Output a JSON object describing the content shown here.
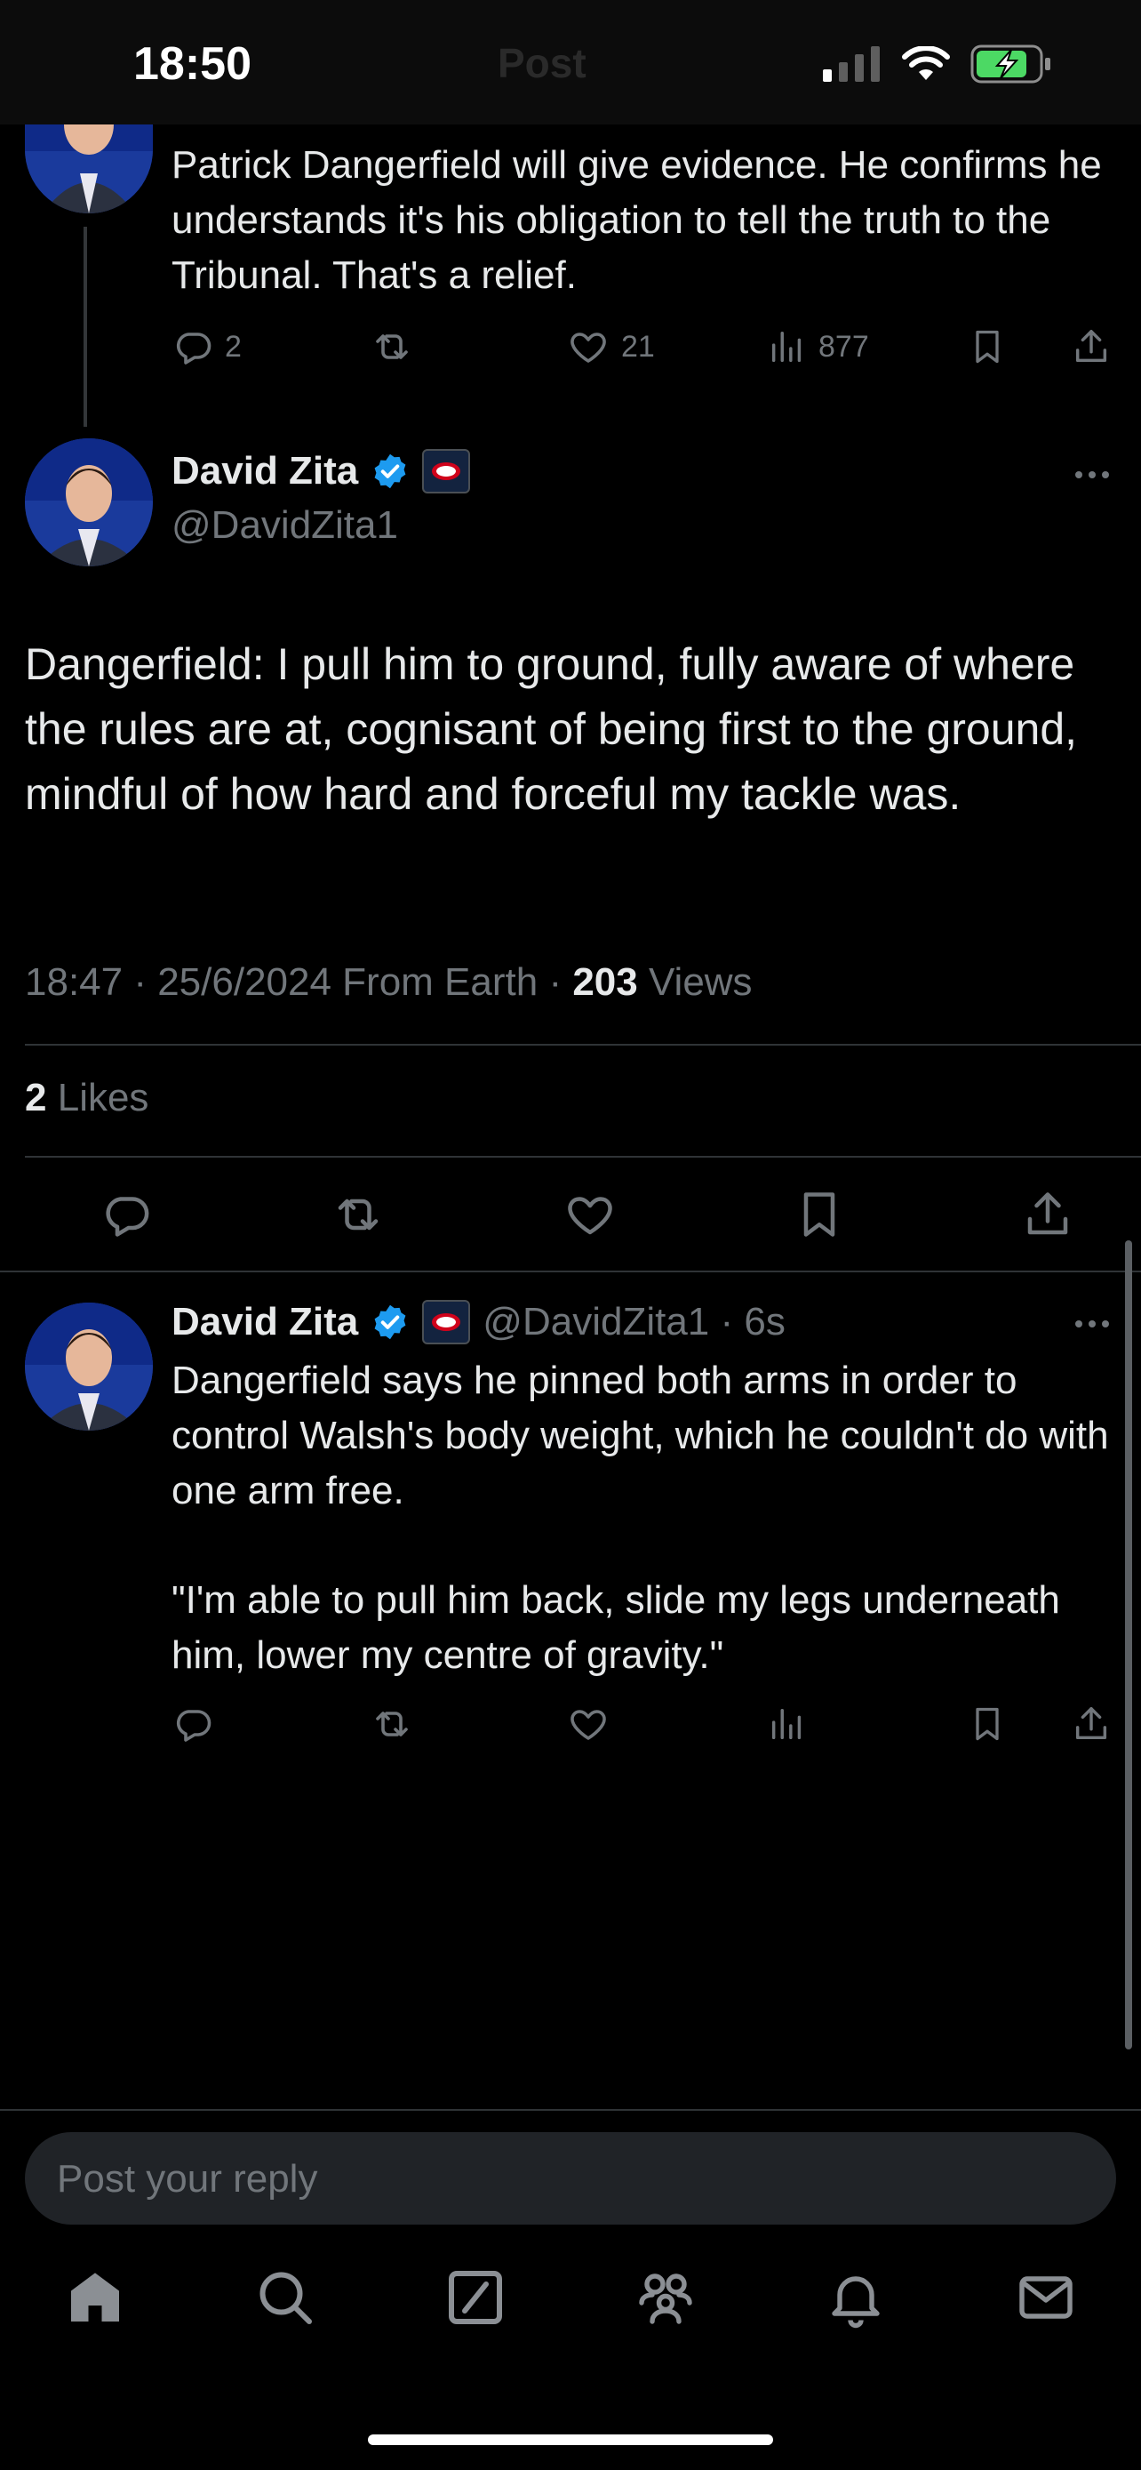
{
  "status_bar": {
    "time": "18:50",
    "faded_header": "Post",
    "battery_color": "#4cd964"
  },
  "parent_tweet": {
    "text": "Patrick Dangerfield will give evidence. He confirms he understands it's his obligation to tell the truth to the Tribunal. That's a relief.",
    "replies": "2",
    "reposts": "",
    "likes": "21",
    "views": "877"
  },
  "main_tweet": {
    "name": "David Zita",
    "handle": "@DavidZita1",
    "text": "Dangerfield: I pull him to ground, fully aware of where the rules are at, cognisant of being first to the ground, mindful of how hard and forceful my tackle was.",
    "meta_prefix": "18:47 · 25/6/2024 From Earth · ",
    "views_count": "203",
    "views_label": "Views",
    "likes_count": "2",
    "likes_label": "Likes"
  },
  "reply_tweet": {
    "name": "David Zita",
    "handle_time": "@DavidZita1 · 6s",
    "text_1": "Dangerfield says he pinned both arms in order to control Walsh's body weight, which he couldn't do with one arm free.",
    "text_2": "\"I'm able to pull him back, slide my legs underneath him, lower my centre of gravity.\""
  },
  "reply_input": {
    "placeholder": "Post your reply"
  },
  "tab_bar": [
    "home-icon",
    "search-icon",
    "grok-icon",
    "communities-icon",
    "notifications-icon",
    "messages-icon"
  ],
  "colors": {
    "verified": "#1d9bf0",
    "muted": "#71767b",
    "background": "#000000"
  }
}
